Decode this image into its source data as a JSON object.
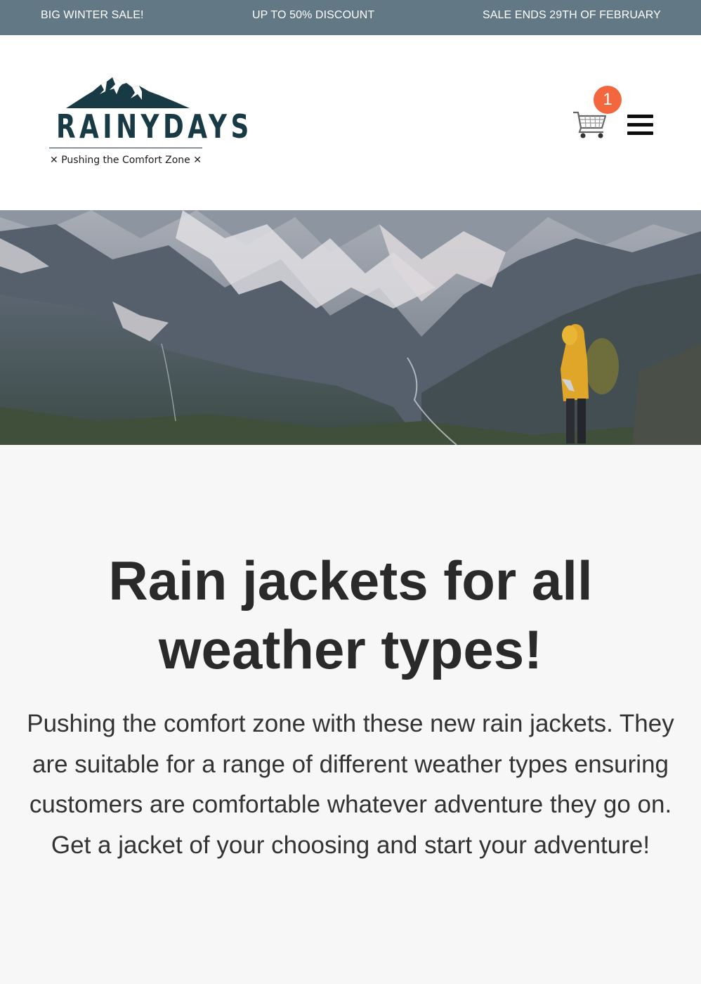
{
  "announcement_bar": {
    "items": [
      "BIG WINTER SALE!",
      "UP TO 50% DISCOUNT",
      "SALE ENDS 29TH OF FEBRUARY"
    ]
  },
  "header": {
    "logo": {
      "brand": "RAINYDAYS",
      "tagline": "Pushing the Comfort Zone"
    },
    "cart": {
      "icon": "shopping-cart-icon",
      "count": "1"
    },
    "menu": {
      "icon": "hamburger-menu-icon"
    }
  },
  "hero": {
    "image": "hiker-in-yellow-rain-jacket-mountain-valley"
  },
  "main": {
    "heading": "Rain jackets for all weather types!",
    "body": "Pushing the comfort zone with these new rain jackets. They are suitable for a range of different weather types ensuring customers are comfortable whatever adventure they go on. Get a jacket of your choosing and start your adventure!"
  },
  "colors": {
    "announcement_bg": "#627985",
    "brand": "#183a45",
    "badge": "#f2673e",
    "page_bg": "#f7f7f7"
  }
}
